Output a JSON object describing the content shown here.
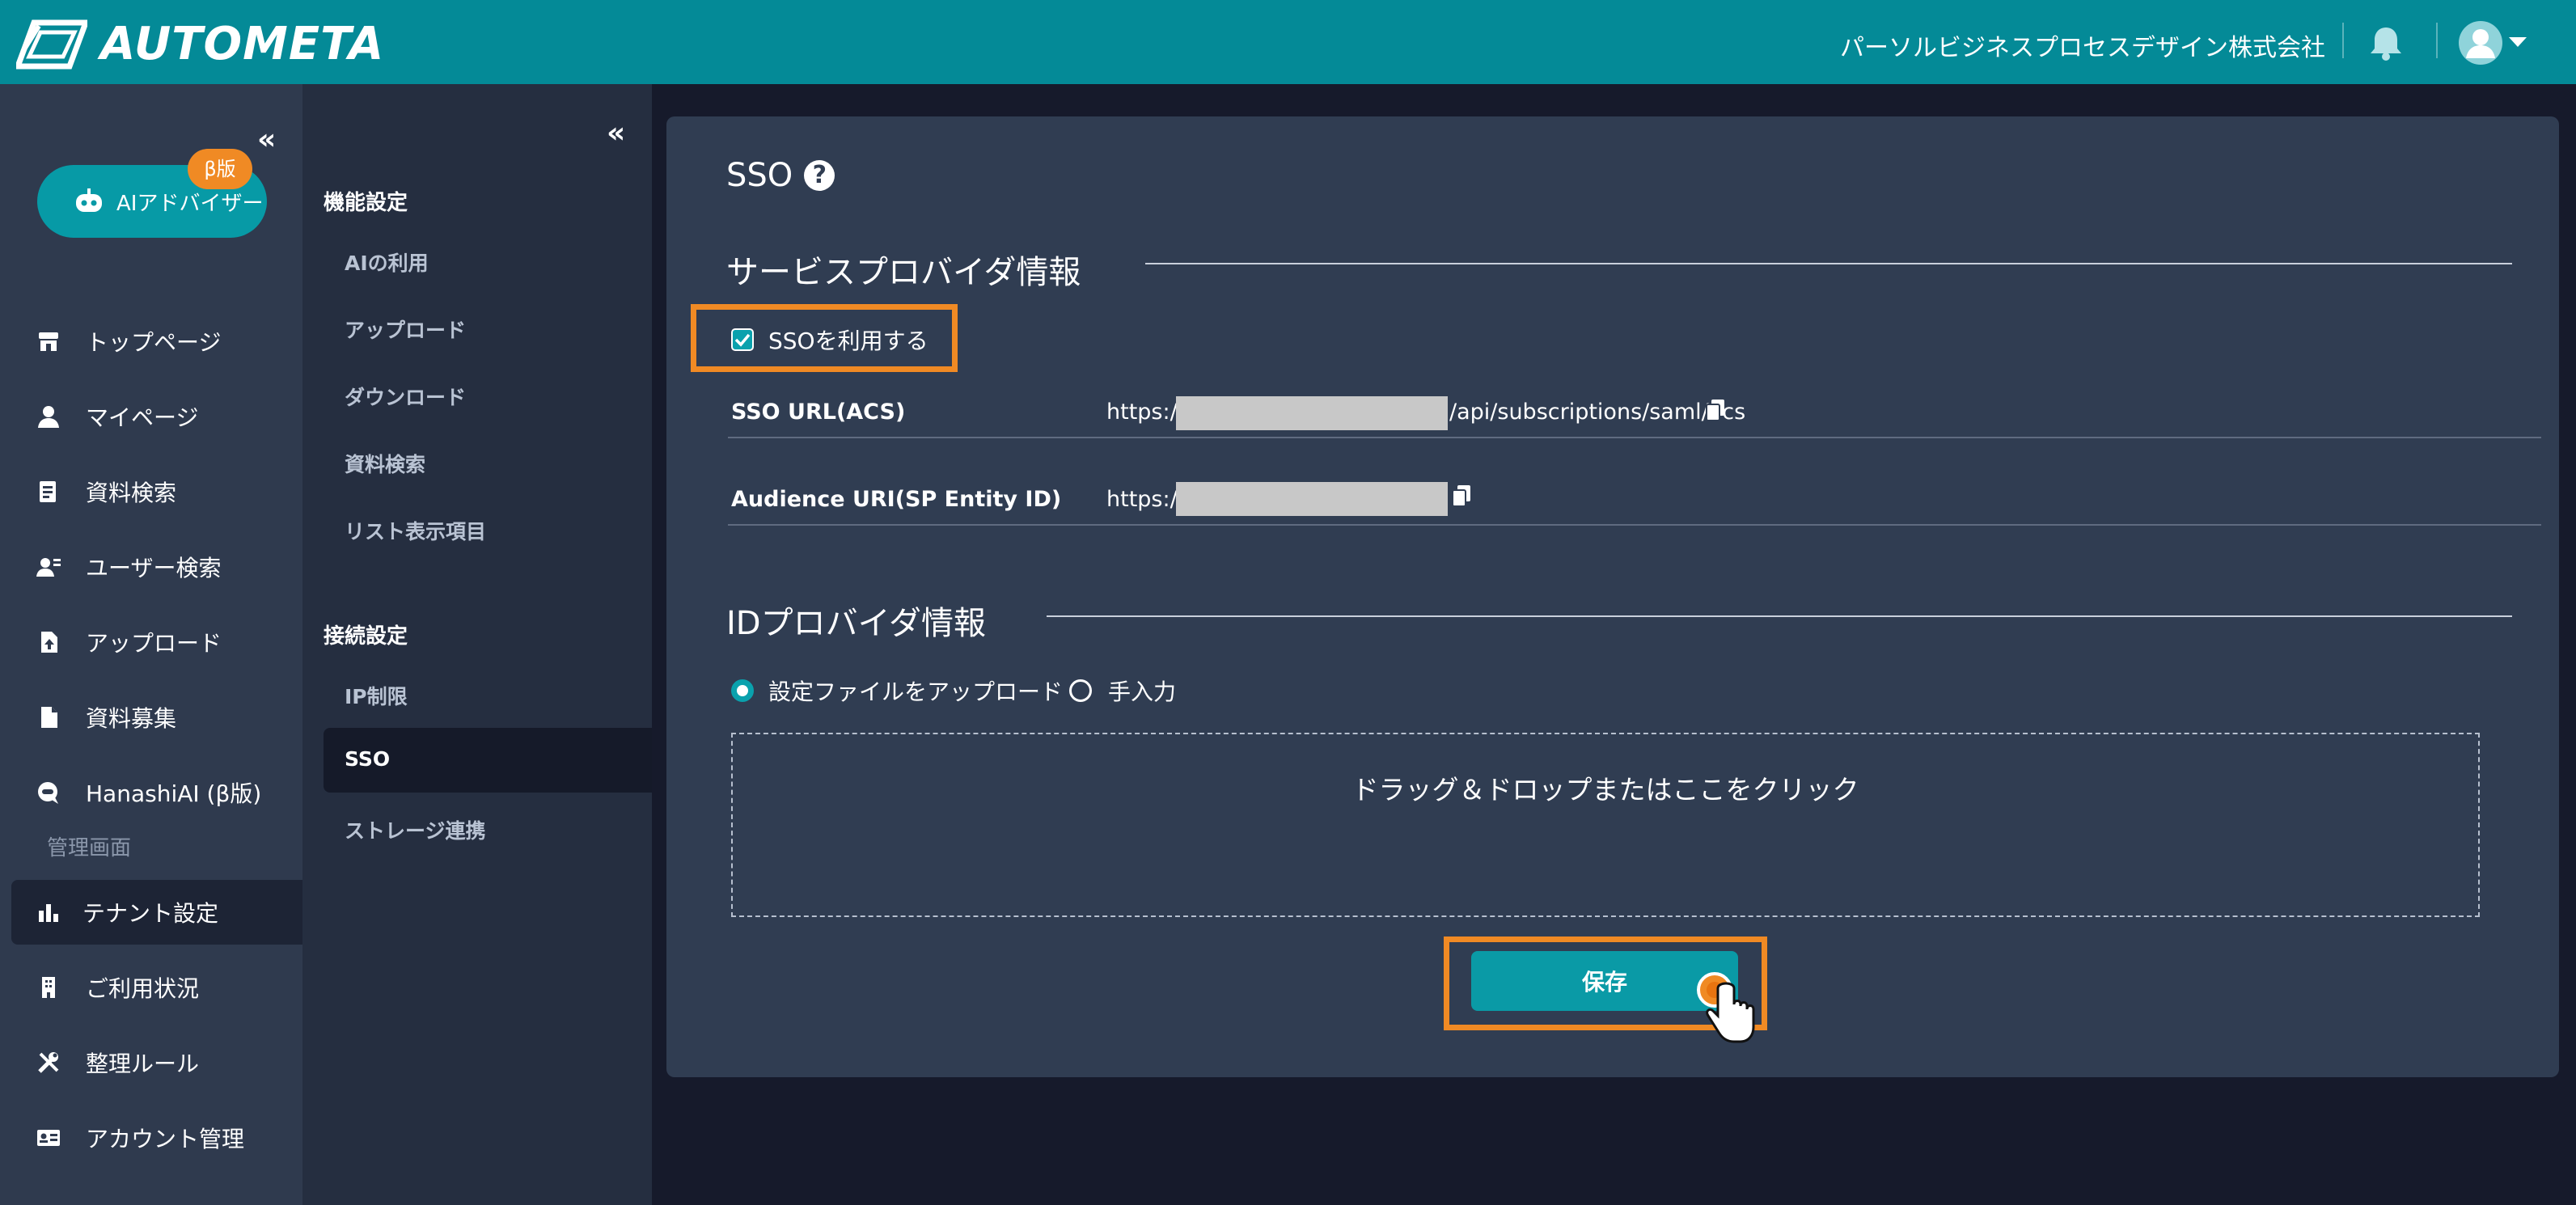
{
  "colors": {
    "topbar": "#048a97",
    "accent": "#0aa1ad",
    "highlight": "#f08a24",
    "panel": "#303d52",
    "sidebar": "#2f3a4e"
  },
  "header": {
    "logo_text": "AUTOMETA",
    "company": "パーソルビジネスプロセスデザイン株式会社",
    "bell_icon": "bell-icon",
    "avatar_icon": "user-avatar-icon"
  },
  "sidebar": {
    "collapse": "«",
    "ai_button": {
      "label": "AIアドバイザー",
      "badge": "β版",
      "icon": "robot-icon"
    },
    "items": [
      {
        "label": "トップページ",
        "icon": "store-icon"
      },
      {
        "label": "マイページ",
        "icon": "person-icon"
      },
      {
        "label": "資料検索",
        "icon": "document-search-icon"
      },
      {
        "label": "ユーザー検索",
        "icon": "user-search-icon"
      },
      {
        "label": "アップロード",
        "icon": "file-upload-icon"
      },
      {
        "label": "資料募集",
        "icon": "file-icon"
      },
      {
        "label": "HanashiAI (β版)",
        "icon": "chat-icon"
      }
    ],
    "admin_label": "管理画面",
    "admin_items": [
      {
        "label": "テナント設定",
        "icon": "building-chart-icon",
        "active": true
      },
      {
        "label": "ご利用状況",
        "icon": "office-building-icon"
      },
      {
        "label": "整理ルール",
        "icon": "tools-icon"
      },
      {
        "label": "アカウント管理",
        "icon": "id-card-icon"
      }
    ]
  },
  "subnav": {
    "collapse": "«",
    "group1_title": "機能設定",
    "group1_items": [
      "AIの利用",
      "アップロード",
      "ダウンロード",
      "資料検索",
      "リスト表示項目"
    ],
    "group2_title": "接続設定",
    "group2_items": [
      "IP制限",
      "SSO",
      "ストレージ連携"
    ],
    "active": "SSO"
  },
  "main": {
    "title": "SSO",
    "help": "?",
    "sp_section": "サービスプロバイダ情報",
    "sso_checkbox_label": "SSOを利用する",
    "sso_checked": true,
    "sso_url_label": "SSO URL(ACS)",
    "sso_url_prefix": "https://",
    "sso_url_suffix": "/api/subscriptions/saml/acs",
    "audience_label": "Audience URI(SP Entity ID)",
    "audience_prefix": "https://",
    "idp_section": "IDプロバイダ情報",
    "radio_upload": "設定ファイルをアップロード",
    "radio_manual": "手入力",
    "radio_selected": "設定ファイルをアップロード",
    "dropzone_text": "ドラッグ＆ドロップまたはここをクリック",
    "save_label": "保存"
  }
}
